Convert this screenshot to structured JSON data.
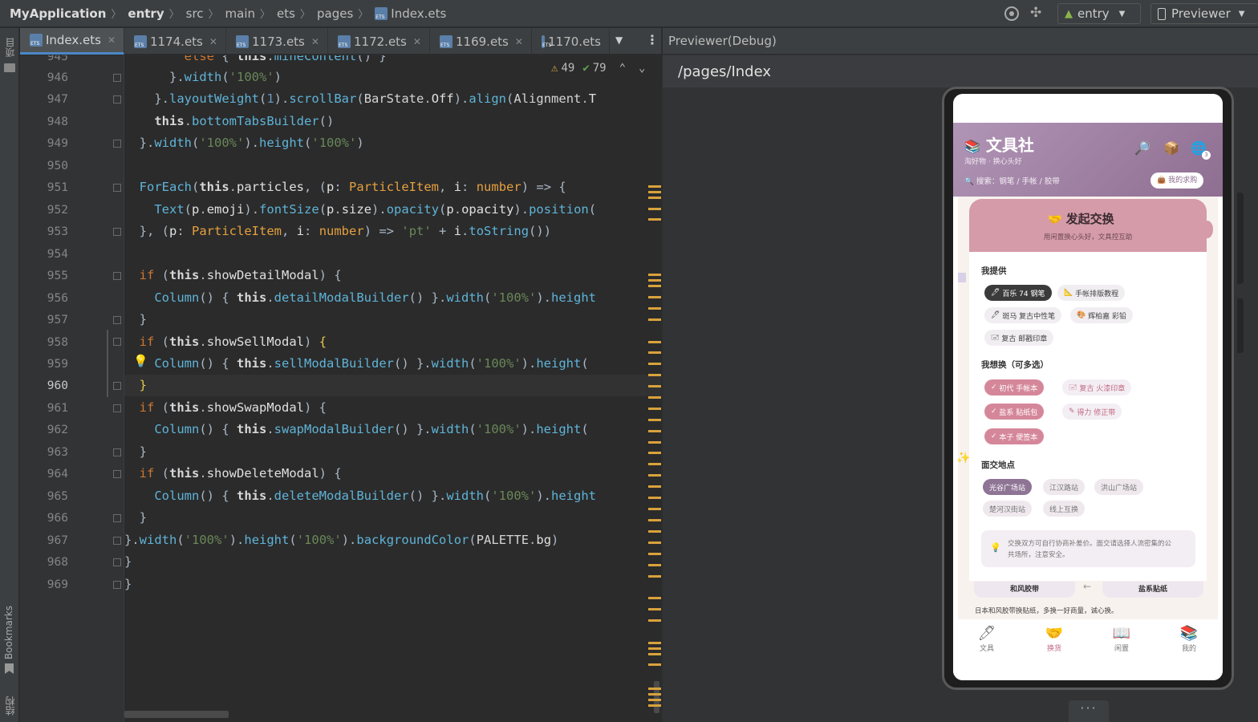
{
  "breadcrumb": {
    "project": "MyApplication",
    "parts": [
      "entry",
      "src",
      "main",
      "ets",
      "pages"
    ],
    "file": "Index.ets"
  },
  "toolbar": {
    "module": "entry",
    "previewer": "Previewer"
  },
  "left_strip": {
    "project_label": "项目",
    "bookmarks_label": "Bookmarks",
    "structure_label": "结构"
  },
  "tabs": [
    {
      "label": "Index.ets",
      "active": true
    },
    {
      "label": "1174.ets"
    },
    {
      "label": "1173.ets"
    },
    {
      "label": "1172.ets"
    },
    {
      "label": "1169.ets"
    },
    {
      "label": "1170.ets"
    }
  ],
  "inspection": {
    "warnings": "49",
    "ok": "79"
  },
  "editor": {
    "current_line": "960",
    "line_numbers": [
      "945",
      "946",
      "947",
      "948",
      "949",
      "950",
      "951",
      "952",
      "953",
      "954",
      "955",
      "956",
      "957",
      "958",
      "959",
      "960",
      "961",
      "962",
      "963",
      "964",
      "965",
      "966",
      "967",
      "968",
      "969"
    ]
  },
  "previewer": {
    "title": "Previewer(Debug)",
    "path": "/pages/Index"
  },
  "app": {
    "name": "文具社",
    "slogan": "淘好物 · 换心头好",
    "search_placeholder": "搜索：钢笔 / 手帐 / 胶带",
    "wish_button": "我的求购",
    "notification_count": "3",
    "modal": {
      "title": "发起交换",
      "subtitle": "用闲置换心头好，文具控互助",
      "offer_title": "我提供",
      "offer_items": [
        "百乐 74 钢笔",
        "手帐排版教程",
        "斑马 复古中性笔",
        "辉柏嘉 彩铅",
        "复古 邮戳印章"
      ],
      "want_title": "我想换（可多选）",
      "want_items": [
        "初代 手帐本",
        "复古 火漆印章",
        "盐系 贴纸包",
        "得力 修正带",
        "本子 便签本"
      ],
      "place_title": "面交地点",
      "places": [
        "光谷广场站",
        "江汉路站",
        "洪山广场站",
        "楚河汉街站",
        "线上互换"
      ],
      "tip": "交换双方可自行协商补差价。面交请选择人流密集的公共场所，注意安全。"
    },
    "swap_card": {
      "left": "和风胶带",
      "right": "盐系贴纸",
      "desc": "日本和风胶带换贴纸，多换一好商量，诚心换。"
    },
    "nav": [
      "文具",
      "换货",
      "闲置",
      "我的"
    ]
  }
}
